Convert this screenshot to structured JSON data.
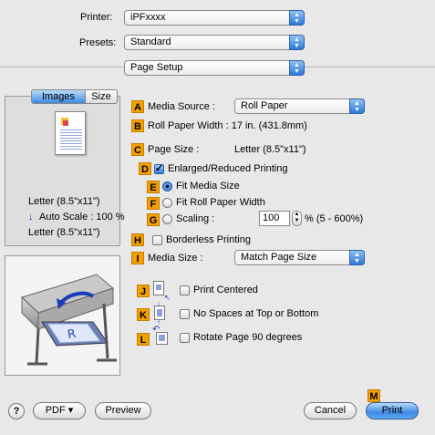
{
  "header": {
    "printer_label": "Printer:",
    "printer_value": "iPFxxxx",
    "presets_label": "Presets:",
    "presets_value": "Standard",
    "panel_value": "Page Setup"
  },
  "tabs": {
    "images": "Images",
    "size": "Size"
  },
  "preview_info": {
    "line1": "Letter (8.5\"x11\")",
    "scale": "Auto Scale : 100 %",
    "line3": "Letter (8.5\"x11\")"
  },
  "badges": [
    "A",
    "B",
    "C",
    "D",
    "E",
    "F",
    "G",
    "H",
    "I",
    "J",
    "K",
    "L",
    "M"
  ],
  "settings": {
    "media_source_label": "Media Source :",
    "media_source_value": "Roll Paper",
    "roll_width_label": "Roll Paper Width : 17 in. (431.8mm)",
    "page_size_label": "Page Size :",
    "page_size_value": "Letter (8.5\"x11\")",
    "enlarged_label": "Enlarged/Reduced Printing",
    "fit_media_label": "Fit Media Size",
    "fit_roll_label": "Fit Roll Paper Width",
    "scaling_label": "Scaling :",
    "scaling_value": "100",
    "scaling_range": "% (5 - 600%)",
    "borderless_label": "Borderless Printing",
    "media_size_label": "Media Size :",
    "media_size_value": "Match Page Size",
    "print_centered_label": "Print Centered",
    "no_spaces_label": "No Spaces at Top or Bottom",
    "rotate_label": "Rotate Page 90 degrees"
  },
  "footer": {
    "help": "?",
    "pdf": "PDF ▾",
    "preview": "Preview",
    "cancel": "Cancel",
    "print": "Print"
  }
}
